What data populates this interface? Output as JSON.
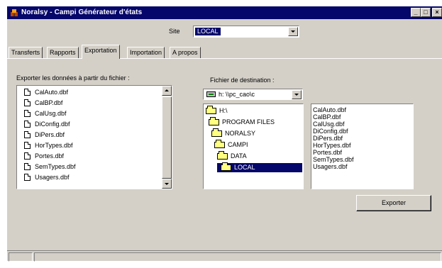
{
  "window": {
    "title": "Noralsy - Campi Générateur d'états",
    "icon": "app-icon",
    "controls": [
      "_",
      "□",
      "×"
    ]
  },
  "site": {
    "label": "Site",
    "value": "LOCAL"
  },
  "tabs": [
    {
      "label": "Transferts",
      "active": false
    },
    {
      "label": "Rapports",
      "active": false
    },
    {
      "label": "Exportation",
      "active": true
    },
    {
      "label": "Importation",
      "active": false
    },
    {
      "label": "A propos",
      "active": false
    }
  ],
  "source": {
    "label": "Exporter les données à partir du fichier :",
    "files": [
      "CalAuto.dbf",
      "CalBP.dbf",
      "CalUsg.dbf",
      "DiConfig.dbf",
      "DiPers.dbf",
      "HorTypes.dbf",
      "Portes.dbf",
      "SemTypes.dbf",
      "Usagers.dbf"
    ]
  },
  "destination": {
    "label": "Fichier de destination :",
    "drive": "h: \\\\pc_cao\\c",
    "folders": [
      {
        "label": "H:\\",
        "selected": false
      },
      {
        "label": "PROGRAM FILES",
        "selected": false
      },
      {
        "label": "NORALSY",
        "selected": false
      },
      {
        "label": "CAMPI",
        "selected": false
      },
      {
        "label": "DATA",
        "selected": false
      },
      {
        "label": "LOCAL",
        "selected": true
      }
    ],
    "files": [
      "CalAuto.dbf",
      "CalBP.dbf",
      "CalUsg.dbf",
      "DiConfig.dbf",
      "DiPers.dbf",
      "HorTypes.dbf",
      "Portes.dbf",
      "SemTypes.dbf",
      "Usagers.dbf"
    ]
  },
  "actions": {
    "export_label": "Exporter"
  },
  "colors": {
    "titlebar": "#06076a",
    "face": "#d4d0c8",
    "selection": "#06076a"
  }
}
